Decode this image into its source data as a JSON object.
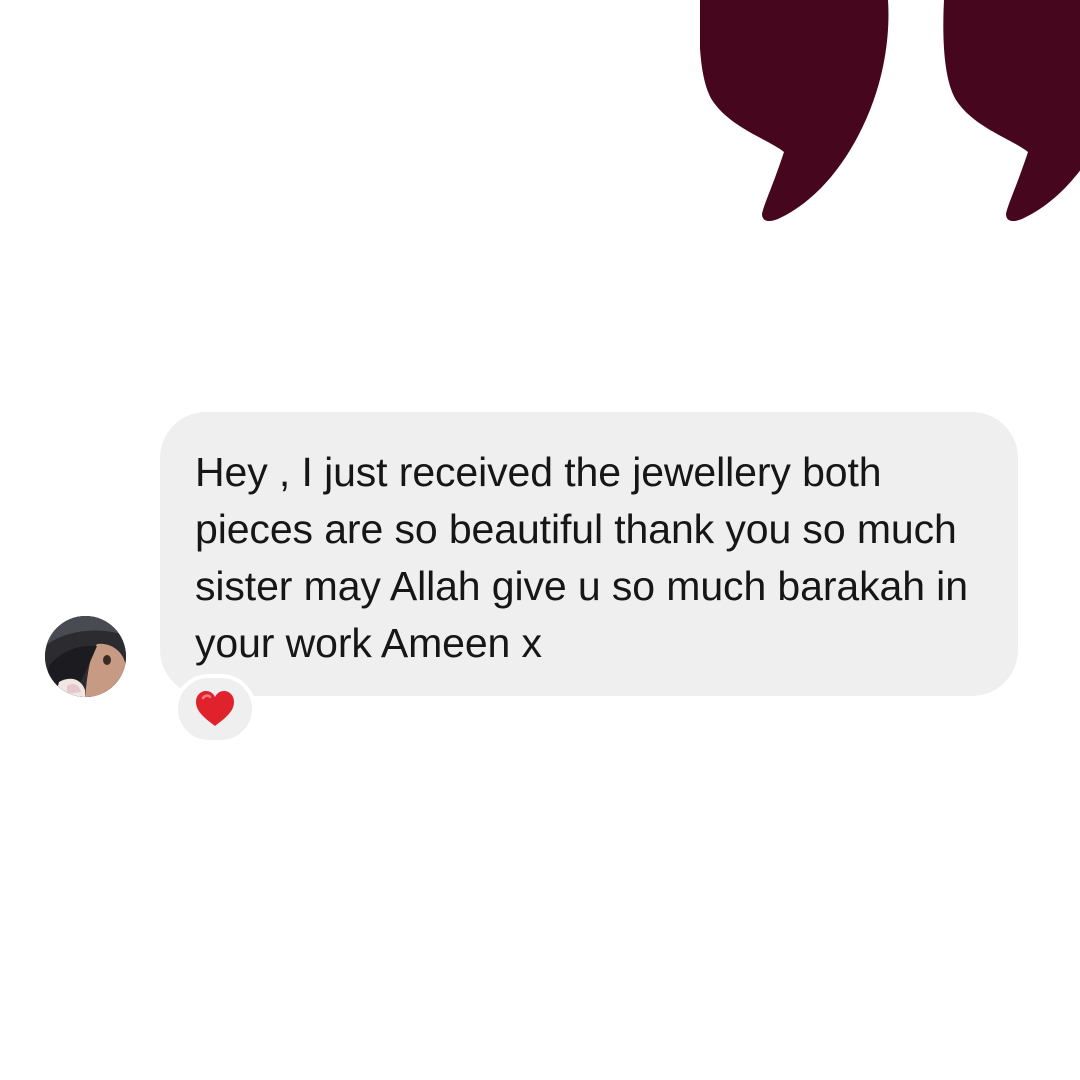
{
  "colors": {
    "quote_mark": "#46061e",
    "bubble_background": "#efefef",
    "message_text": "#161616",
    "reaction_heart": "#e0222d",
    "page_background": "#ffffff"
  },
  "decoration": {
    "icon": "closing-quotation-mark-icon"
  },
  "conversation": {
    "sender_avatar_icon": "avatar-icon",
    "message": {
      "text": "Hey , I just received the jewellery both pieces are so beautiful thank you so much sister may Allah give u so much barakah in your work Ameen x",
      "reaction": {
        "icon": "red-heart-icon"
      }
    }
  }
}
